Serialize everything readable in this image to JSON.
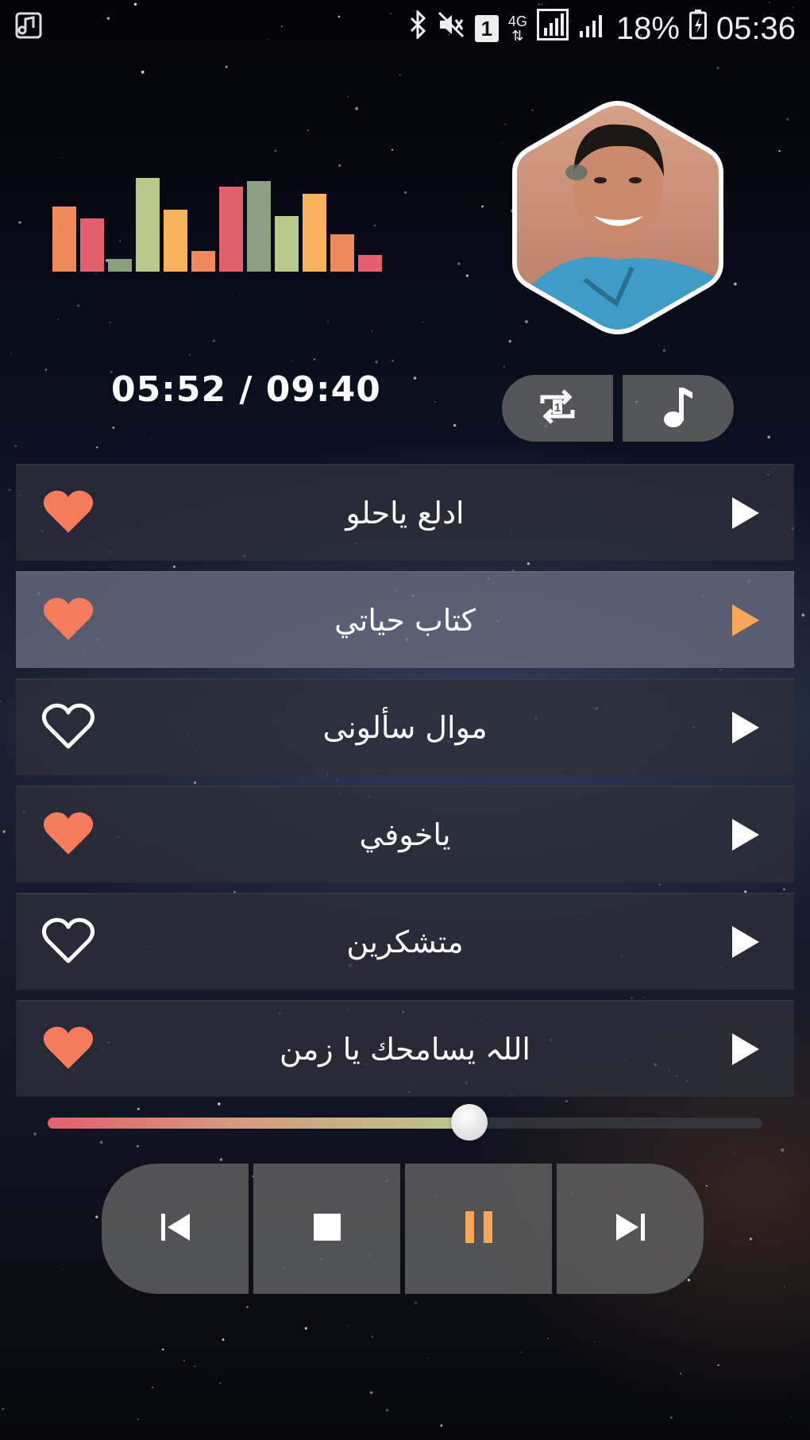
{
  "status_bar": {
    "sim_label": "1",
    "network": "4G",
    "battery": "18%",
    "time": "05:36"
  },
  "player": {
    "time_display": "05:52 / 09:40",
    "progress_fraction": 0.59,
    "visualizer_levels": [
      0.58,
      0.47,
      0.11,
      0.83,
      0.55,
      0.18,
      0.75,
      0.8,
      0.49,
      0.69,
      0.33,
      0.15
    ],
    "visualizer_colors": [
      "#f08a5d",
      "#e0606e",
      "#8aa081",
      "#b9c88d",
      "#f9b35e",
      "#f08a5d",
      "#e0606e",
      "#8aa081",
      "#b9c88d",
      "#f9b35e",
      "#f08a5d",
      "#e0606e"
    ],
    "accent_color": "#f9a55a",
    "heart_color": "#f47c5c"
  },
  "playlist": [
    {
      "title": "ادلع ياحلو",
      "favorite": true,
      "active": false
    },
    {
      "title": "كتاب حياتي",
      "favorite": true,
      "active": true
    },
    {
      "title": "موال سألونى",
      "favorite": false,
      "active": false
    },
    {
      "title": "ياخوفي",
      "favorite": true,
      "active": false
    },
    {
      "title": "متشكرين",
      "favorite": false,
      "active": false
    },
    {
      "title": "اللہ يسامحك يا زمن",
      "favorite": true,
      "active": false
    }
  ],
  "controls": {
    "mode_buttons": [
      "repeat-one-icon",
      "music-note-icon"
    ],
    "transport": [
      "previous-icon",
      "stop-icon",
      "pause-icon",
      "next-icon"
    ]
  }
}
